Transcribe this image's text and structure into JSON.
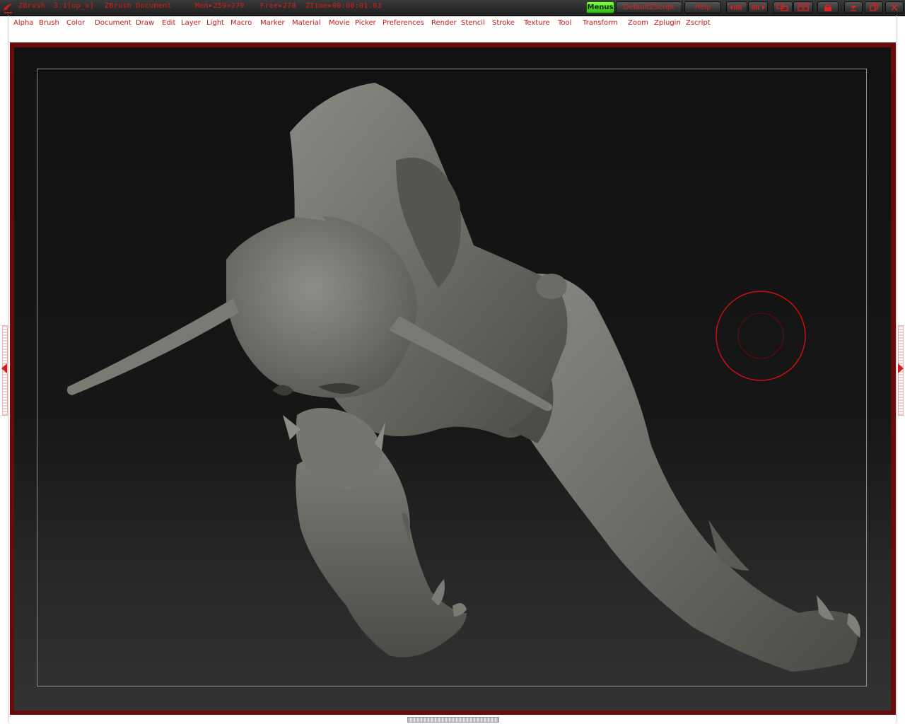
{
  "titlebar": {
    "app_name": "ZBrush",
    "version": "3.1[op_x]",
    "document": "ZBrush Document",
    "mem_label": "Mem",
    "mem_value": "259+279",
    "free_label": "Free",
    "free_value": "278",
    "ztime_label": "ZTime",
    "ztime_value": "00:00:01.03",
    "menus_button": "Menus",
    "script_button": "DefaultZScript",
    "help_button": "Help"
  },
  "menubar": {
    "items": [
      "Alpha",
      "Brush",
      "Color",
      "Document",
      "Draw",
      "Edit",
      "Layer",
      "Light",
      "Macro",
      "Marker",
      "Material",
      "Movie",
      "Picker",
      "Preferences",
      "Render",
      "Stencil",
      "Stroke",
      "Texture",
      "Tool",
      "Transform",
      "Zoom",
      "Zplugin",
      "Zscript"
    ]
  },
  "icons": {
    "logo": "zbrush-logo-icon",
    "window_controls": [
      "layout-prev-icon",
      "layout-next-icon",
      "layout-swap-icon",
      "layout-dock-icon",
      "lock-icon",
      "minimize-icon",
      "restore-icon",
      "close-icon"
    ]
  },
  "colors": {
    "accent": "#d41e1e",
    "menus_active": "#45d41c",
    "canvas_frame": "#6a0a0a",
    "model": "#6f6f69"
  }
}
